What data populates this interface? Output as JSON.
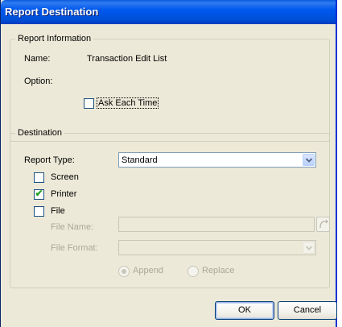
{
  "window": {
    "title": "Report Destination"
  },
  "report_info": {
    "legend": "Report Information",
    "name_label": "Name:",
    "name_value": "Transaction Edit List",
    "option_label": "Option:",
    "ask_each_time_label": "Ask Each Time",
    "ask_each_time_checked": false
  },
  "destination": {
    "legend": "Destination",
    "report_type_label": "Report Type:",
    "report_type_value": "Standard",
    "screen_label": "Screen",
    "screen_checked": false,
    "printer_label": "Printer",
    "printer_checked": true,
    "file_label": "File",
    "file_checked": false,
    "file_name_label": "File Name:",
    "file_name_value": "",
    "file_format_label": "File Format:",
    "file_format_value": "",
    "append_label": "Append",
    "append_selected": true,
    "replace_label": "Replace",
    "replace_selected": false
  },
  "buttons": {
    "ok_label": "OK",
    "cancel_label": "Cancel"
  },
  "icons": {
    "dropdown": "chevron-down-icon",
    "checkmark": "check-icon",
    "browse": "folder-browse-icon"
  },
  "colors": {
    "title_bar": "#0058ee",
    "dialog_bg": "#ece9d8",
    "check": "#21a121"
  }
}
